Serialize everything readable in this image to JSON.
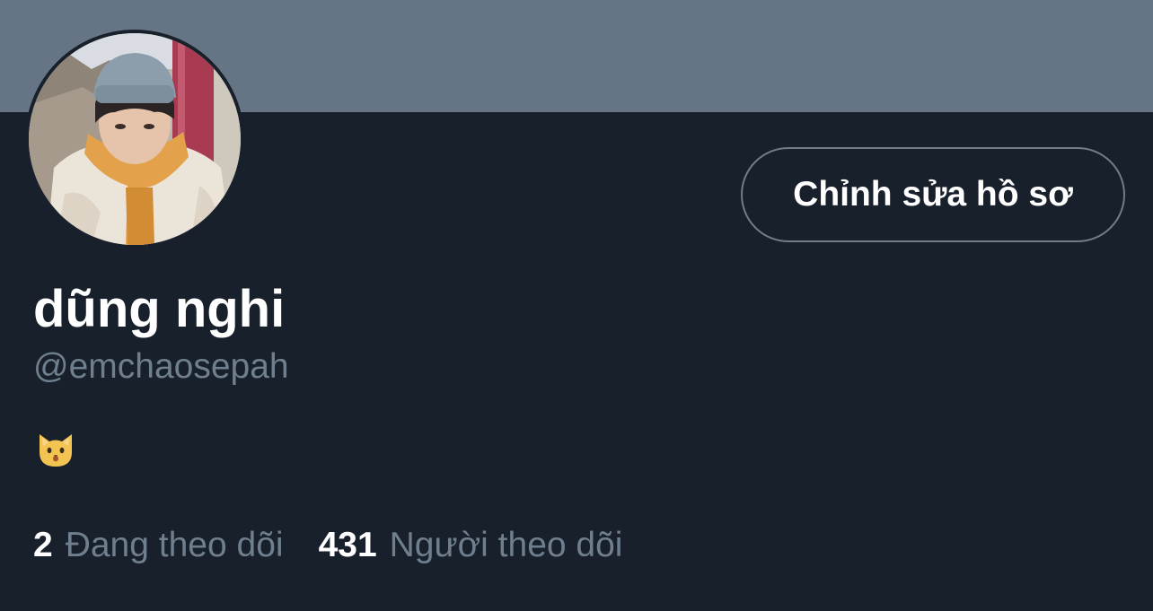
{
  "profile": {
    "display_name": "dũng nghi",
    "handle": "@emchaosepah",
    "bio_icon": "cat-face-icon",
    "edit_button_label": "Chỉnh sửa hồ sơ"
  },
  "stats": {
    "following_count": "2",
    "following_label": "Đang theo dõi",
    "followers_count": "431",
    "followers_label": "Người theo dõi"
  },
  "colors": {
    "background": "#18202b",
    "banner": "#667585",
    "primary_text": "#ffffff",
    "secondary_text": "#6f7f8e",
    "button_border": "#6f7c89"
  }
}
